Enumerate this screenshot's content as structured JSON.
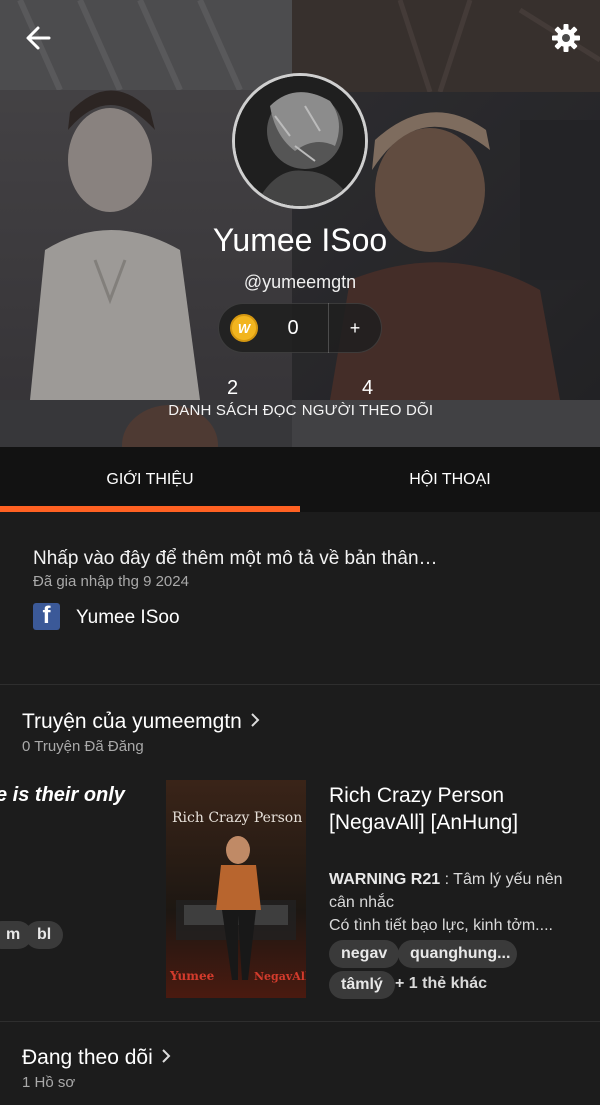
{
  "profile": {
    "name": "Yumee ISoo",
    "handle": "@yumeemgtn",
    "coins": "0",
    "coin_plus": "+",
    "coin_logo": "W",
    "reading_lists_count": "2",
    "reading_lists_label": "DANH SÁCH ĐỌC",
    "followers_count": "4",
    "followers_label": "NGƯỜI THEO DÕI"
  },
  "tabs": [
    {
      "label": "GIỚI THIỆU",
      "active": true
    },
    {
      "label": "HỘI THOẠI",
      "active": false
    }
  ],
  "about": {
    "description": "Nhấp vào đây để thêm một mô tả về bản thân…",
    "joined": "Đã gia nhập thg 9 2024",
    "facebook_logo": "f",
    "facebook_name": "Yumee ISoo"
  },
  "stories": {
    "title": "Truyện của yumeemgtn",
    "subtitle": "0 Truyện Đã Đăng",
    "left_card": {
      "title_fragment": "e is their only",
      "tags": [
        "m",
        "bl"
      ]
    },
    "book": {
      "cover_text_top": "Rich Crazy Person",
      "cover_text_bottom_left": "Yumee",
      "cover_text_bottom_right": "NegavAll",
      "title": "Rich Crazy Person [NegavAll] [AnHung]",
      "warning": "WARNING R21",
      "desc_rest": " : Tâm lý yếu nên cân nhắc",
      "desc_line2": "Có tình tiết bạo lực, kinh tởm....",
      "tags": [
        "negav",
        "quanghung...",
        "tâmlý"
      ],
      "more_tags": "+ 1 thẻ khác"
    }
  },
  "following": {
    "title": "Đang theo dõi",
    "subtitle": "1 Hồ sơ"
  },
  "colors": {
    "accent": "#ff6122",
    "background": "#121212",
    "surface": "#1c1c1c",
    "coin": "#f2b51f",
    "facebook": "#3b5998"
  },
  "icons": [
    "back-arrow-icon",
    "gear-icon",
    "coin-icon",
    "facebook-icon",
    "chevron-right-icon"
  ]
}
